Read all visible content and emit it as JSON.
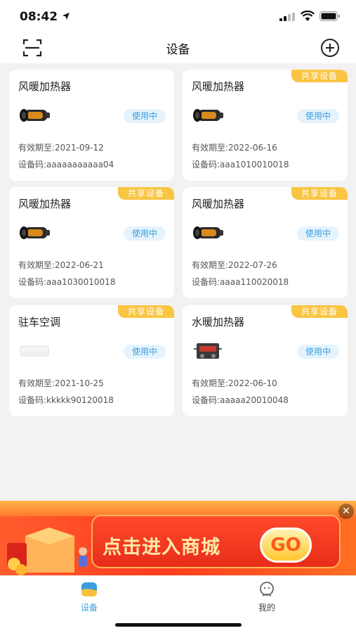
{
  "status_bar": {
    "time": "08:42"
  },
  "header": {
    "title": "设备"
  },
  "devices": [
    {
      "name": "风暖加热器",
      "shared": false,
      "status": "使用中",
      "expire": "有效期至:2021-09-12",
      "code": "设备码:aaaaaaaaaaa04",
      "image": "heater"
    },
    {
      "name": "风暖加热器",
      "shared": true,
      "share_label": "共享设备",
      "status": "使用中",
      "expire": "有效期至:2022-06-16",
      "code": "设备码:aaa1010010018",
      "image": "heater"
    },
    {
      "name": "风暖加热器",
      "shared": true,
      "share_label": "共享设备",
      "status": "使用中",
      "expire": "有效期至:2022-06-21",
      "code": "设备码:aaa1030010018",
      "image": "heater"
    },
    {
      "name": "风暖加热器",
      "shared": true,
      "share_label": "共享设备",
      "status": "使用中",
      "expire": "有效期至:2022-07-26",
      "code": "设备码:aaaa110020018",
      "image": "heater"
    },
    {
      "name": "驻车空调",
      "shared": true,
      "share_label": "共享设备",
      "status": "使用中",
      "expire": "有效期至:2021-10-25",
      "code": "设备码:kkkkk90120018",
      "image": "air-conditioner"
    },
    {
      "name": "水暖加热器",
      "shared": true,
      "share_label": "共享设备",
      "status": "使用中",
      "expire": "有效期至:2022-06-10",
      "code": "设备码:aaaaa20010048",
      "image": "water-heater"
    }
  ],
  "banner": {
    "text": "点击进入商城",
    "button": "GO",
    "close": "✕"
  },
  "tabbar": {
    "items": [
      {
        "label": "设备",
        "active": true
      },
      {
        "label": "我的",
        "active": false
      }
    ]
  },
  "colors": {
    "accent": "#3a9ee0",
    "share_badge": "#f9c543",
    "status_bg": "#e4f3fd",
    "background": "#f2f2f2"
  }
}
